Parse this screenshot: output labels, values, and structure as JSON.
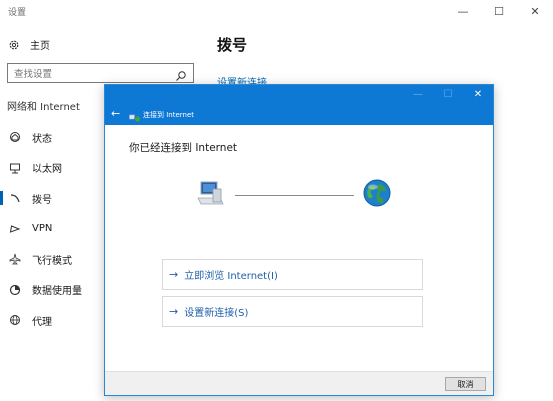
{
  "window": {
    "title": "设置",
    "controls": {
      "minimize": "—",
      "maximize": "☐",
      "close": "✕"
    }
  },
  "nav": {
    "home_label": "主页",
    "search_placeholder": "查找设置",
    "section_title": "网络和 Internet",
    "items": [
      {
        "label": "状态",
        "icon": "home-globe-icon",
        "active": false
      },
      {
        "label": "以太网",
        "icon": "ethernet-icon",
        "active": false
      },
      {
        "label": "拨号",
        "icon": "dialup-icon",
        "active": true
      },
      {
        "label": "VPN",
        "icon": "vpn-icon",
        "active": false
      },
      {
        "label": "飞行模式",
        "icon": "airplane-icon",
        "active": false
      },
      {
        "label": "数据使用量",
        "icon": "data-usage-icon",
        "active": false
      },
      {
        "label": "代理",
        "icon": "globe-icon",
        "active": false
      }
    ]
  },
  "content": {
    "title": "拨号",
    "link": "设置新连接"
  },
  "dialog": {
    "title": "连接到 Internet",
    "heading": "你已经连接到 Internet",
    "controls": {
      "minimize": "—",
      "maximize": "☐",
      "close": "✕"
    },
    "options": [
      {
        "label": "立即浏览 Internet(I)"
      },
      {
        "label": "设置新连接(S)"
      }
    ],
    "cancel_label": "取消"
  },
  "colors": {
    "accent": "#0e78d5",
    "link": "#0066b4",
    "active_indicator": "#0063b1"
  }
}
